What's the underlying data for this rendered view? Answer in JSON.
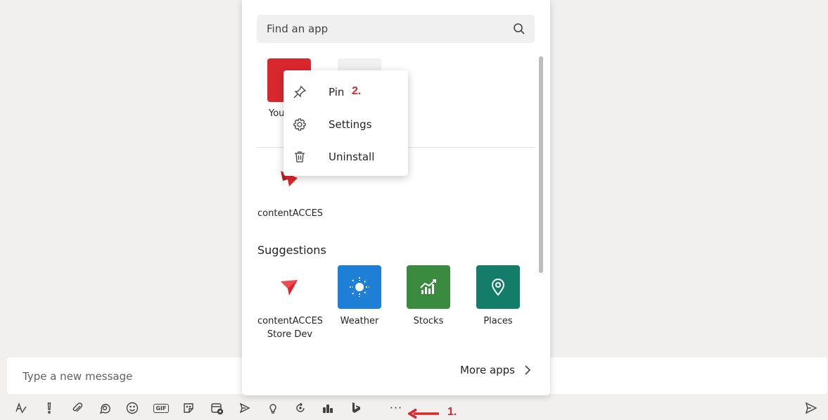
{
  "compose": {
    "placeholder": "Type a new message"
  },
  "toolbar": {
    "icons": [
      "format-icon",
      "important-icon",
      "attach-icon",
      "loop-icon",
      "emoji-icon",
      "gif-icon",
      "sticker-icon",
      "schedule-meeting-icon",
      "stream-icon",
      "praise-icon",
      "updates-icon",
      "stocks-icon",
      "bing-icon",
      "more-icon",
      "send-icon"
    ],
    "gif_label": "GIF",
    "more_label": "···"
  },
  "annotations": {
    "step1": "1.",
    "step2": "2."
  },
  "flyout": {
    "search_placeholder": "Find an app",
    "recent_apps": [
      {
        "label": "You",
        "color": "#d9272e"
      },
      {
        "label": "",
        "color": "#f0f0f0"
      }
    ],
    "installed_apps": [
      {
        "label": "contentACCES"
      }
    ],
    "suggestions_title": "Suggestions",
    "suggestions": [
      {
        "label": "contentACCES Store Dev",
        "line1": "contentACCES",
        "line2": "Store Dev",
        "color": "#ffffff",
        "icon": "paper-plane-icon"
      },
      {
        "label": "Weather",
        "color": "#1e7fd6",
        "icon": "sun-icon"
      },
      {
        "label": "Stocks",
        "color": "#3a8a3f",
        "icon": "chart-icon"
      },
      {
        "label": "Places",
        "color": "#137d6a",
        "icon": "location-pin-icon"
      }
    ],
    "more_apps_label": "More apps"
  },
  "context_menu": {
    "items": [
      {
        "label": "Pin",
        "icon": "pin-icon"
      },
      {
        "label": "Settings",
        "icon": "gear-icon"
      },
      {
        "label": "Uninstall",
        "icon": "trash-icon"
      }
    ]
  },
  "colors": {
    "accent_red": "#d9272e",
    "background": "#f1f0ef"
  }
}
